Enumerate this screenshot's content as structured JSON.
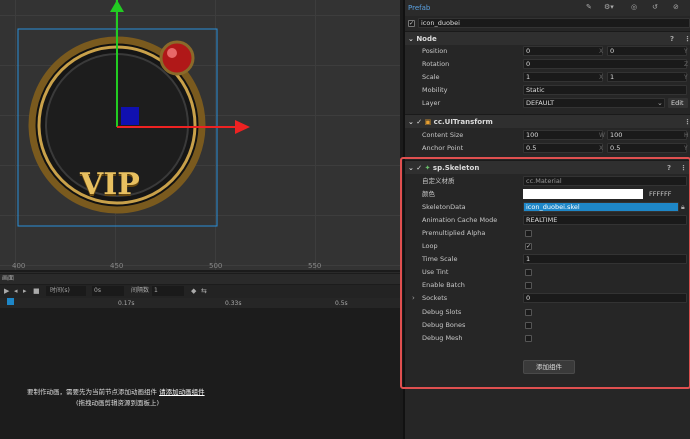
{
  "scene": {
    "ruler_x": [
      "400",
      "450",
      "500",
      "550"
    ],
    "vip_text": "VIP"
  },
  "anim": {
    "title": "画面",
    "time_unit": "时间(s)",
    "time_value": "0s",
    "interval_label": "间隔数",
    "interval_value": "1",
    "ticks": [
      "0.17s",
      "0.33s",
      "0.5s"
    ],
    "msg_line1": "要制作动画，需要先为当前节点添加动画组件",
    "msg_link": "请添加动画组件",
    "msg_line2": "(拖拽动画剪辑资源到面板上)"
  },
  "inspector": {
    "header": "Prefab",
    "node_name": "icon_duobei",
    "node_section": "Node",
    "position": {
      "label": "Position",
      "x": "0",
      "y": "0"
    },
    "rotation": {
      "label": "Rotation",
      "z": "0"
    },
    "scale": {
      "label": "Scale",
      "x": "1",
      "y": "1"
    },
    "mobility": {
      "label": "Mobility",
      "value": "Static"
    },
    "layer": {
      "label": "Layer",
      "value": "DEFAULT",
      "edit": "Edit"
    },
    "ui_section": "cc.UITransform",
    "content_size": {
      "label": "Content Size",
      "w": "100",
      "h": "100"
    },
    "anchor": {
      "label": "Anchor Point",
      "x": "0.5",
      "y": "0.5"
    },
    "sk_section": "sp.Skeleton",
    "custom_material": {
      "label": "自定义材质",
      "value": "cc.Material"
    },
    "color": {
      "label": "颜色",
      "value": "FFFFFF"
    },
    "skeleton_data": {
      "label": "SkeletonData",
      "value": "icon_duobei.skel"
    },
    "cache_mode": {
      "label": "Animation Cache Mode",
      "value": "REALTIME"
    },
    "premult": {
      "label": "Premultiplied Alpha"
    },
    "loop": {
      "label": "Loop"
    },
    "time_scale": {
      "label": "Time Scale",
      "value": "1"
    },
    "use_tint": {
      "label": "Use Tint"
    },
    "enable_batch": {
      "label": "Enable Batch"
    },
    "sockets": {
      "label": "Sockets",
      "value": "0"
    },
    "debug_slots": {
      "label": "Debug Slots"
    },
    "debug_bones": {
      "label": "Debug Bones"
    },
    "debug_mesh": {
      "label": "Debug Mesh"
    },
    "add_component": "添加组件"
  },
  "colors": {
    "highlight": "#e05050",
    "accent_blue": "#1e87c8"
  }
}
